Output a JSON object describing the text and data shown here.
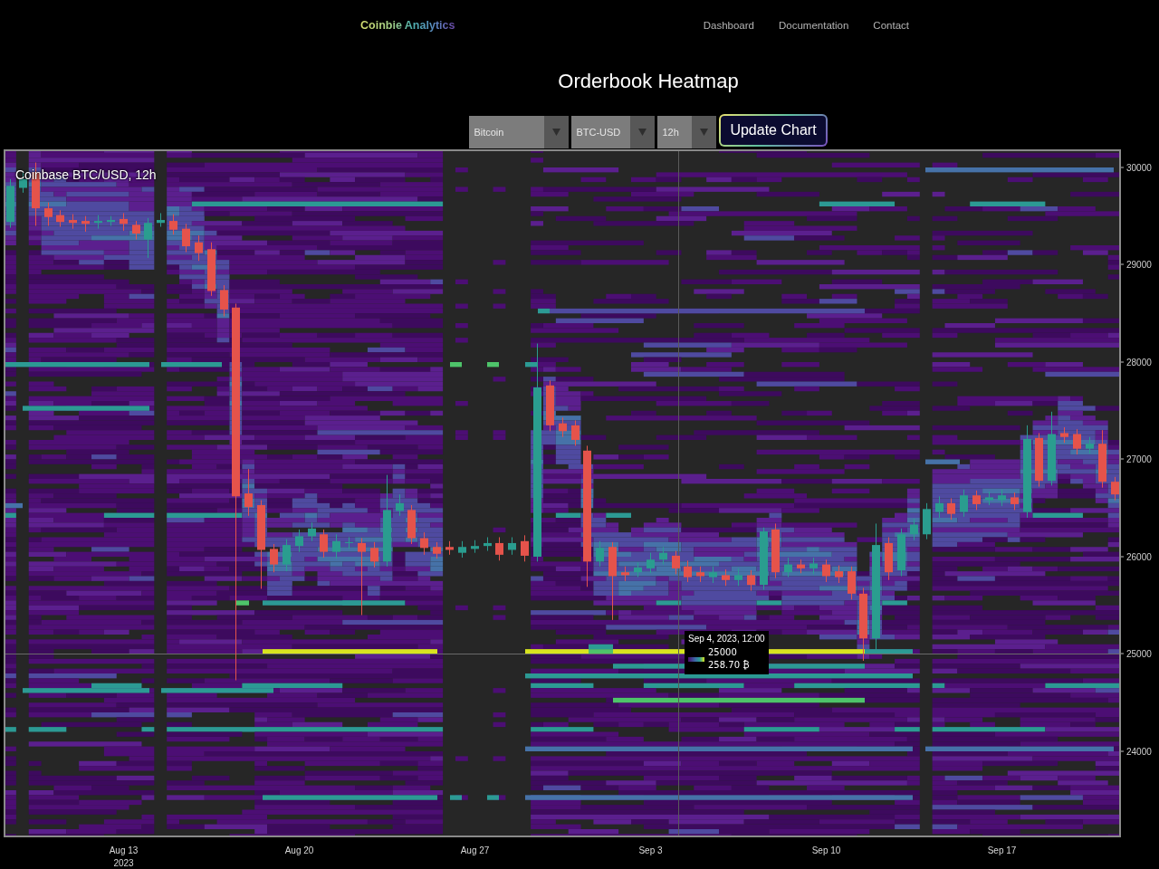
{
  "header": {
    "logo": "Coinbie Analytics",
    "nav": [
      "Dashboard",
      "Documentation",
      "Contact"
    ]
  },
  "page_title": "Orderbook Heatmap",
  "controls": {
    "dropdowns": [
      {
        "value": "Bitcoin"
      },
      {
        "value": "BTC-USD"
      },
      {
        "value": "12h"
      }
    ],
    "button": "Update Chart"
  },
  "chart": {
    "chart_data": {
      "type": "candlestick",
      "title": "Coinbase BTC/USD, 12h",
      "categories": [
        null,
        null,
        null,
        null,
        null,
        null,
        null,
        null,
        null,
        "Aug 13",
        null,
        null,
        null,
        null,
        null,
        null,
        null,
        null,
        null,
        null,
        null,
        null,
        null,
        "Aug 20",
        null,
        null,
        null,
        null,
        null,
        null,
        null,
        null,
        null,
        null,
        null,
        null,
        null,
        "Aug 27",
        null,
        null,
        null,
        null,
        null,
        null,
        null,
        null,
        null,
        null,
        null,
        null,
        null,
        "Sep 3",
        null,
        null,
        null,
        null,
        null,
        null,
        null,
        null,
        null,
        null,
        null,
        null,
        null,
        "Sep 10",
        null,
        null,
        null,
        null,
        null,
        null,
        null,
        null,
        null,
        null,
        null,
        null,
        null,
        "Sep 17",
        null,
        null,
        null,
        null,
        null,
        null,
        null,
        null,
        null
      ],
      "ohlc": [
        [
          29440,
          29880,
          29380,
          29810
        ],
        [
          29790,
          29950,
          29740,
          29880
        ],
        [
          29950,
          30050,
          29400,
          29580
        ],
        [
          29580,
          29640,
          29400,
          29490
        ],
        [
          29510,
          29560,
          29390,
          29440
        ],
        [
          29460,
          29520,
          29370,
          29430
        ],
        [
          29450,
          29500,
          29340,
          29420
        ],
        [
          29430,
          29510,
          29370,
          29450
        ],
        [
          29440,
          29500,
          29400,
          29460
        ],
        [
          29470,
          29530,
          29350,
          29420
        ],
        [
          29410,
          29450,
          29260,
          29320
        ],
        [
          29260,
          29480,
          29070,
          29430
        ],
        [
          29430,
          29530,
          29390,
          29460
        ],
        [
          29450,
          29520,
          29310,
          29360
        ],
        [
          29370,
          29420,
          29130,
          29190
        ],
        [
          29230,
          29300,
          29040,
          29120
        ],
        [
          29160,
          29230,
          28680,
          28730
        ],
        [
          28740,
          28790,
          28470,
          28540
        ],
        [
          28560,
          28600,
          24730,
          26620
        ],
        [
          26650,
          26900,
          26420,
          26510
        ],
        [
          26530,
          26580,
          25670,
          26070
        ],
        [
          26080,
          26130,
          25840,
          25920
        ],
        [
          25920,
          26180,
          25850,
          26120
        ],
        [
          26110,
          26280,
          26050,
          26210
        ],
        [
          26210,
          26350,
          26160,
          26290
        ],
        [
          26230,
          26280,
          25990,
          26050
        ],
        [
          26050,
          26230,
          25980,
          26160
        ],
        [
          26140,
          26200,
          26080,
          26150
        ],
        [
          26140,
          26190,
          25400,
          26050
        ],
        [
          26090,
          26150,
          25890,
          25950
        ],
        [
          25950,
          26840,
          25900,
          26480
        ],
        [
          26470,
          26640,
          26420,
          26550
        ],
        [
          26480,
          26530,
          26130,
          26190
        ],
        [
          26190,
          26250,
          26020,
          26090
        ],
        [
          26100,
          26150,
          25980,
          26030
        ],
        [
          26100,
          26160,
          26020,
          26070
        ],
        [
          26040,
          26160,
          25990,
          26100
        ],
        [
          26080,
          26170,
          26040,
          26110
        ],
        [
          26110,
          26200,
          26060,
          26140
        ],
        [
          26140,
          26200,
          25960,
          26020
        ],
        [
          26070,
          26200,
          26020,
          26140
        ],
        [
          26160,
          26220,
          25950,
          26010
        ],
        [
          26000,
          28190,
          25950,
          27740
        ],
        [
          27760,
          27810,
          27290,
          27350
        ],
        [
          27370,
          27430,
          27230,
          27290
        ],
        [
          27350,
          27400,
          27140,
          27200
        ],
        [
          27090,
          27140,
          25690,
          25950
        ],
        [
          25950,
          26160,
          25900,
          26090
        ],
        [
          26100,
          26150,
          25350,
          25800
        ],
        [
          25840,
          25900,
          25750,
          25810
        ],
        [
          25840,
          25940,
          25790,
          25890
        ],
        [
          25880,
          26040,
          25830,
          25970
        ],
        [
          25970,
          26100,
          25920,
          26040
        ],
        [
          26010,
          26060,
          25820,
          25880
        ],
        [
          25900,
          25960,
          25740,
          25790
        ],
        [
          25840,
          25900,
          25740,
          25800
        ],
        [
          25790,
          25900,
          25730,
          25840
        ],
        [
          25810,
          25870,
          25700,
          25760
        ],
        [
          25760,
          25880,
          25700,
          25810
        ],
        [
          25810,
          25860,
          25650,
          25710
        ],
        [
          25710,
          26300,
          25660,
          26260
        ],
        [
          26280,
          26340,
          25780,
          25840
        ],
        [
          25840,
          25990,
          25790,
          25920
        ],
        [
          25920,
          25970,
          25830,
          25880
        ],
        [
          25880,
          25990,
          25820,
          25930
        ],
        [
          25920,
          25970,
          25740,
          25800
        ],
        [
          25850,
          25910,
          25730,
          25790
        ],
        [
          25850,
          25900,
          25560,
          25620
        ],
        [
          25620,
          25680,
          24930,
          25160
        ],
        [
          25160,
          26340,
          25020,
          26120
        ],
        [
          26140,
          26200,
          25760,
          25840
        ],
        [
          25860,
          26290,
          25800,
          26230
        ],
        [
          26230,
          26390,
          26170,
          26330
        ],
        [
          26230,
          26550,
          26180,
          26490
        ],
        [
          26460,
          26620,
          26400,
          26550
        ],
        [
          26550,
          26600,
          26380,
          26440
        ],
        [
          26460,
          26690,
          26410,
          26630
        ],
        [
          26630,
          26680,
          26480,
          26540
        ],
        [
          26580,
          26670,
          26530,
          26610
        ],
        [
          26580,
          26690,
          26520,
          26630
        ],
        [
          26610,
          26660,
          26480,
          26540
        ],
        [
          26460,
          27350,
          26400,
          27210
        ],
        [
          27220,
          27270,
          26720,
          26780
        ],
        [
          26780,
          27490,
          26730,
          27260
        ],
        [
          27270,
          27330,
          27170,
          27230
        ],
        [
          27260,
          27310,
          27050,
          27110
        ],
        [
          27110,
          27230,
          27060,
          27160
        ],
        [
          27160,
          27300,
          26710,
          26770
        ],
        [
          26770,
          26820,
          26580,
          26640
        ]
      ],
      "ylim": [
        23135,
        30167
      ],
      "yticks": [
        30000,
        29000,
        28000,
        27000,
        26000,
        25000,
        24000
      ]
    },
    "year_label": "2023",
    "tooltip": {
      "time": "Sep 4, 2023, 12:00",
      "price": "25000",
      "amount": "258.70 ₿"
    }
  }
}
